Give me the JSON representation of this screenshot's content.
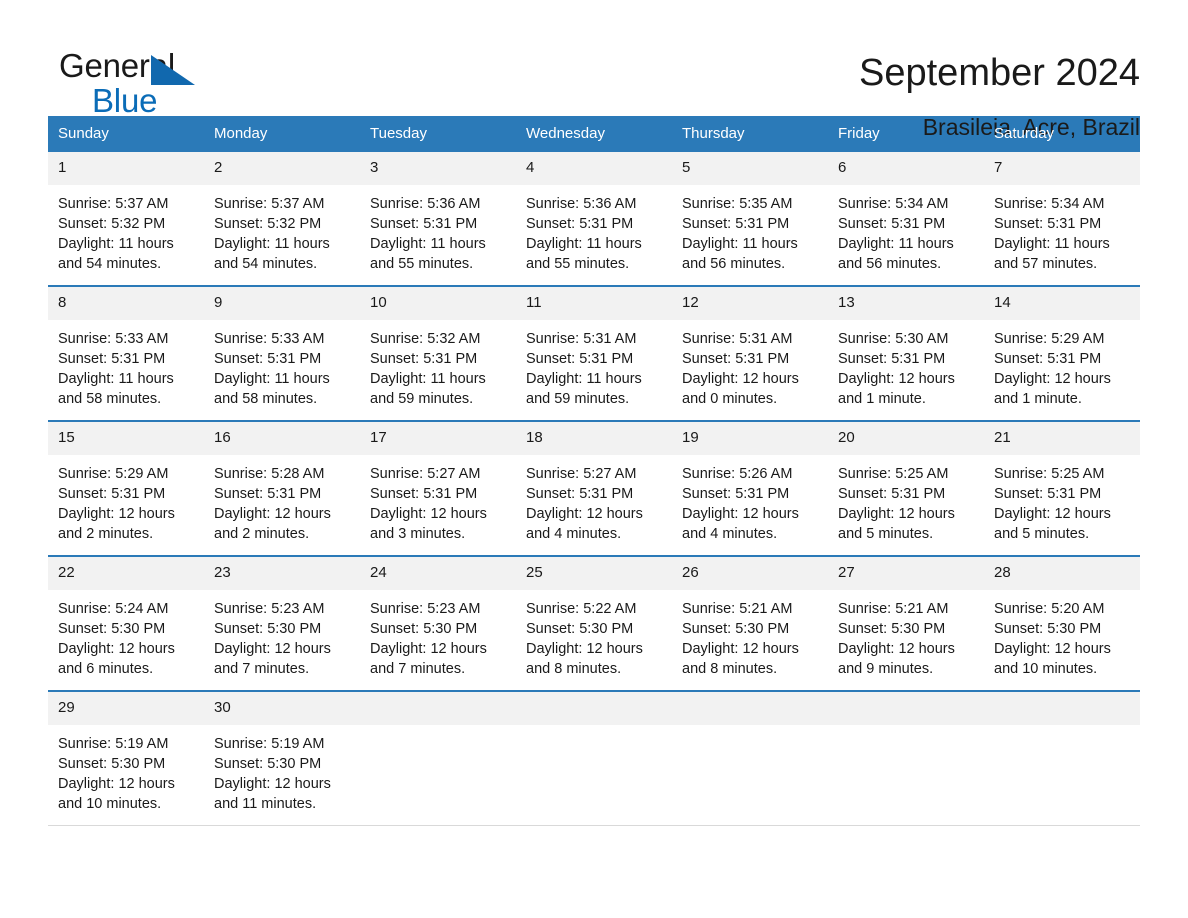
{
  "brand": {
    "line1": "General",
    "line2": "Blue",
    "triangle_color": "#1168ae"
  },
  "header": {
    "title": "September 2024",
    "subtitle": "Brasileia, Acre, Brazil",
    "accent_color": "#2b7ab8",
    "daynum_band_color": "#f2f2f2"
  },
  "calendar": {
    "weekdays": [
      "Sunday",
      "Monday",
      "Tuesday",
      "Wednesday",
      "Thursday",
      "Friday",
      "Saturday"
    ],
    "weeks": [
      [
        {
          "day": "1",
          "sunrise": "Sunrise: 5:37 AM",
          "sunset": "Sunset: 5:32 PM",
          "daylight": "Daylight: 11 hours and 54 minutes."
        },
        {
          "day": "2",
          "sunrise": "Sunrise: 5:37 AM",
          "sunset": "Sunset: 5:32 PM",
          "daylight": "Daylight: 11 hours and 54 minutes."
        },
        {
          "day": "3",
          "sunrise": "Sunrise: 5:36 AM",
          "sunset": "Sunset: 5:31 PM",
          "daylight": "Daylight: 11 hours and 55 minutes."
        },
        {
          "day": "4",
          "sunrise": "Sunrise: 5:36 AM",
          "sunset": "Sunset: 5:31 PM",
          "daylight": "Daylight: 11 hours and 55 minutes."
        },
        {
          "day": "5",
          "sunrise": "Sunrise: 5:35 AM",
          "sunset": "Sunset: 5:31 PM",
          "daylight": "Daylight: 11 hours and 56 minutes."
        },
        {
          "day": "6",
          "sunrise": "Sunrise: 5:34 AM",
          "sunset": "Sunset: 5:31 PM",
          "daylight": "Daylight: 11 hours and 56 minutes."
        },
        {
          "day": "7",
          "sunrise": "Sunrise: 5:34 AM",
          "sunset": "Sunset: 5:31 PM",
          "daylight": "Daylight: 11 hours and 57 minutes."
        }
      ],
      [
        {
          "day": "8",
          "sunrise": "Sunrise: 5:33 AM",
          "sunset": "Sunset: 5:31 PM",
          "daylight": "Daylight: 11 hours and 58 minutes."
        },
        {
          "day": "9",
          "sunrise": "Sunrise: 5:33 AM",
          "sunset": "Sunset: 5:31 PM",
          "daylight": "Daylight: 11 hours and 58 minutes."
        },
        {
          "day": "10",
          "sunrise": "Sunrise: 5:32 AM",
          "sunset": "Sunset: 5:31 PM",
          "daylight": "Daylight: 11 hours and 59 minutes."
        },
        {
          "day": "11",
          "sunrise": "Sunrise: 5:31 AM",
          "sunset": "Sunset: 5:31 PM",
          "daylight": "Daylight: 11 hours and 59 minutes."
        },
        {
          "day": "12",
          "sunrise": "Sunrise: 5:31 AM",
          "sunset": "Sunset: 5:31 PM",
          "daylight": "Daylight: 12 hours and 0 minutes."
        },
        {
          "day": "13",
          "sunrise": "Sunrise: 5:30 AM",
          "sunset": "Sunset: 5:31 PM",
          "daylight": "Daylight: 12 hours and 1 minute."
        },
        {
          "day": "14",
          "sunrise": "Sunrise: 5:29 AM",
          "sunset": "Sunset: 5:31 PM",
          "daylight": "Daylight: 12 hours and 1 minute."
        }
      ],
      [
        {
          "day": "15",
          "sunrise": "Sunrise: 5:29 AM",
          "sunset": "Sunset: 5:31 PM",
          "daylight": "Daylight: 12 hours and 2 minutes."
        },
        {
          "day": "16",
          "sunrise": "Sunrise: 5:28 AM",
          "sunset": "Sunset: 5:31 PM",
          "daylight": "Daylight: 12 hours and 2 minutes."
        },
        {
          "day": "17",
          "sunrise": "Sunrise: 5:27 AM",
          "sunset": "Sunset: 5:31 PM",
          "daylight": "Daylight: 12 hours and 3 minutes."
        },
        {
          "day": "18",
          "sunrise": "Sunrise: 5:27 AM",
          "sunset": "Sunset: 5:31 PM",
          "daylight": "Daylight: 12 hours and 4 minutes."
        },
        {
          "day": "19",
          "sunrise": "Sunrise: 5:26 AM",
          "sunset": "Sunset: 5:31 PM",
          "daylight": "Daylight: 12 hours and 4 minutes."
        },
        {
          "day": "20",
          "sunrise": "Sunrise: 5:25 AM",
          "sunset": "Sunset: 5:31 PM",
          "daylight": "Daylight: 12 hours and 5 minutes."
        },
        {
          "day": "21",
          "sunrise": "Sunrise: 5:25 AM",
          "sunset": "Sunset: 5:31 PM",
          "daylight": "Daylight: 12 hours and 5 minutes."
        }
      ],
      [
        {
          "day": "22",
          "sunrise": "Sunrise: 5:24 AM",
          "sunset": "Sunset: 5:30 PM",
          "daylight": "Daylight: 12 hours and 6 minutes."
        },
        {
          "day": "23",
          "sunrise": "Sunrise: 5:23 AM",
          "sunset": "Sunset: 5:30 PM",
          "daylight": "Daylight: 12 hours and 7 minutes."
        },
        {
          "day": "24",
          "sunrise": "Sunrise: 5:23 AM",
          "sunset": "Sunset: 5:30 PM",
          "daylight": "Daylight: 12 hours and 7 minutes."
        },
        {
          "day": "25",
          "sunrise": "Sunrise: 5:22 AM",
          "sunset": "Sunset: 5:30 PM",
          "daylight": "Daylight: 12 hours and 8 minutes."
        },
        {
          "day": "26",
          "sunrise": "Sunrise: 5:21 AM",
          "sunset": "Sunset: 5:30 PM",
          "daylight": "Daylight: 12 hours and 8 minutes."
        },
        {
          "day": "27",
          "sunrise": "Sunrise: 5:21 AM",
          "sunset": "Sunset: 5:30 PM",
          "daylight": "Daylight: 12 hours and 9 minutes."
        },
        {
          "day": "28",
          "sunrise": "Sunrise: 5:20 AM",
          "sunset": "Sunset: 5:30 PM",
          "daylight": "Daylight: 12 hours and 10 minutes."
        }
      ],
      [
        {
          "day": "29",
          "sunrise": "Sunrise: 5:19 AM",
          "sunset": "Sunset: 5:30 PM",
          "daylight": "Daylight: 12 hours and 10 minutes."
        },
        {
          "day": "30",
          "sunrise": "Sunrise: 5:19 AM",
          "sunset": "Sunset: 5:30 PM",
          "daylight": "Daylight: 12 hours and 11 minutes."
        },
        {
          "day": "",
          "sunrise": "",
          "sunset": "",
          "daylight": ""
        },
        {
          "day": "",
          "sunrise": "",
          "sunset": "",
          "daylight": ""
        },
        {
          "day": "",
          "sunrise": "",
          "sunset": "",
          "daylight": ""
        },
        {
          "day": "",
          "sunrise": "",
          "sunset": "",
          "daylight": ""
        },
        {
          "day": "",
          "sunrise": "",
          "sunset": "",
          "daylight": ""
        }
      ]
    ]
  }
}
